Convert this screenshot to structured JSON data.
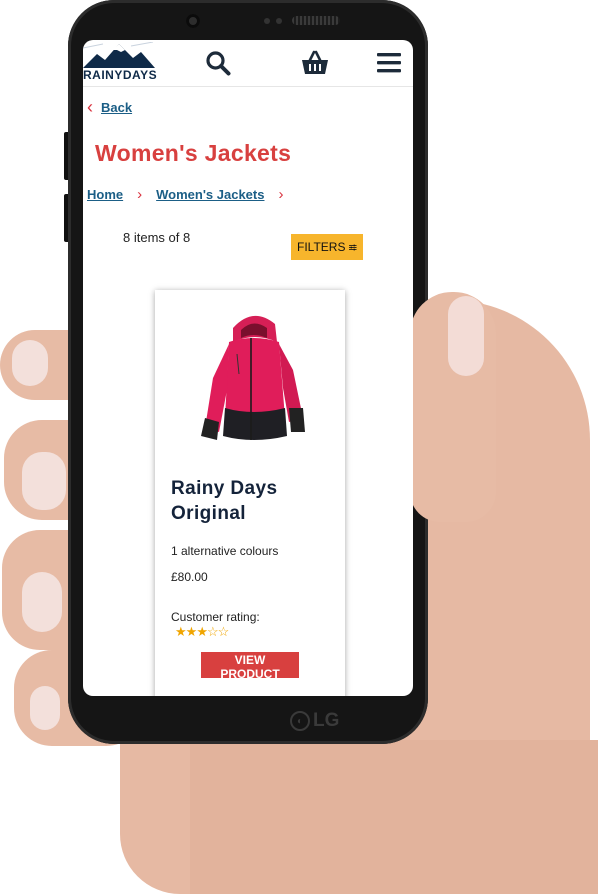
{
  "header": {
    "logo_text": "RAINYDAYS"
  },
  "nav": {
    "back_label": "Back"
  },
  "page": {
    "title": "Women's Jackets"
  },
  "breadcrumb": {
    "items": [
      "Home",
      "Women's Jackets"
    ]
  },
  "results": {
    "count_text": "8 items of 8",
    "filters_label": "FILTERS"
  },
  "product": {
    "name_line1": "Rainy Days",
    "name_line2": "Original",
    "alt_colours": "1 alternative colours",
    "price": "£80.00",
    "rating_label": "Customer rating:",
    "rating_fraction": 0.6,
    "button_label": "VIEW PRODUCT"
  },
  "device": {
    "brand": "LG"
  },
  "colors": {
    "title_red": "#d8403f",
    "filters_yellow": "#f7b52c",
    "link_blue": "#1b5e86",
    "navy": "#14233a"
  }
}
